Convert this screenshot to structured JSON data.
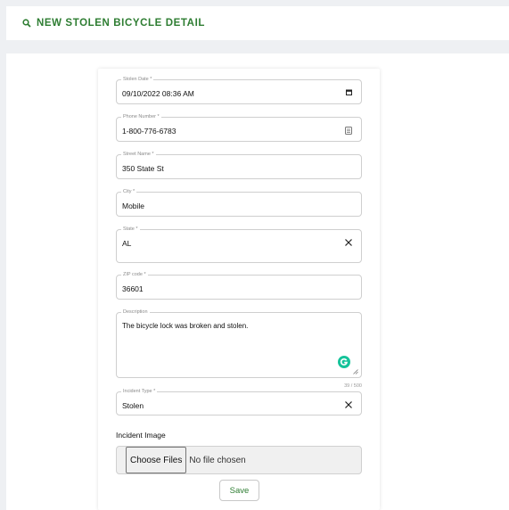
{
  "header": {
    "title": "NEW STOLEN BICYCLE DETAIL"
  },
  "form": {
    "stolen_date": {
      "label": "Stolen Date *",
      "value": "09/10/2022 08:36 AM"
    },
    "phone": {
      "label": "Phone Number *",
      "value": "1-800-776-6783"
    },
    "street": {
      "label": "Street Name *",
      "value": "350 State St"
    },
    "city": {
      "label": "City *",
      "value": "Mobile"
    },
    "state": {
      "label": "State *",
      "value": "AL"
    },
    "zip": {
      "label": "ZIP code *",
      "value": "36601"
    },
    "description": {
      "label": "Description",
      "value": "The bicycle lock was broken and stolen.",
      "counter": "39 / 500"
    },
    "incident_type": {
      "label": "Incident Type *",
      "value": "Stolen"
    },
    "incident_image": {
      "label": "Incident Image",
      "button": "Choose Files",
      "status": "No file chosen"
    },
    "save_label": "Save"
  },
  "colors": {
    "accent": "#2e7d32",
    "grammarly": "#15c39a"
  }
}
